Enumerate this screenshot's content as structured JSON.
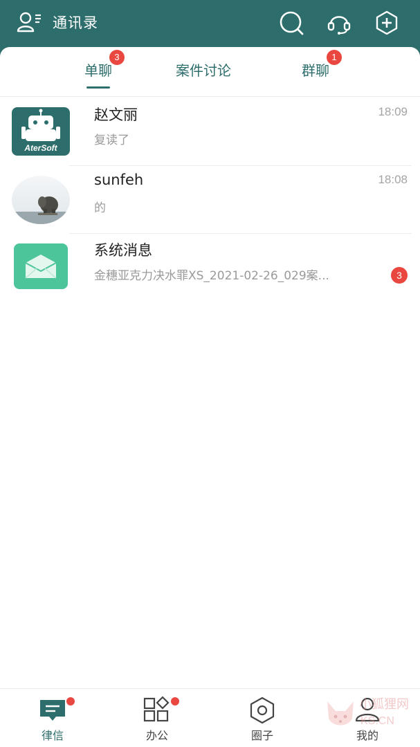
{
  "header": {
    "contacts_label": "通讯录",
    "icons": [
      "contacts-icon",
      "search-icon",
      "headset-icon",
      "add-icon"
    ]
  },
  "tabs": [
    {
      "label": "单聊",
      "badge": "3",
      "active": true
    },
    {
      "label": "案件讨论",
      "badge": "",
      "active": false
    },
    {
      "label": "群聊",
      "badge": "1",
      "active": false
    }
  ],
  "chats": [
    {
      "name": "赵文丽",
      "time": "18:09",
      "message": "复读了",
      "avatar_text": "AterSoft",
      "badge": ""
    },
    {
      "name": "sunfeh",
      "time": "18:08",
      "message": "的",
      "avatar_text": "",
      "badge": ""
    },
    {
      "name": "系统消息",
      "time": "",
      "message": "金穗亚克力决水罪XS_2021-02-26_029案...",
      "avatar_text": "",
      "badge": "3"
    }
  ],
  "bottom_nav": [
    {
      "label": "律信",
      "active": true,
      "dot": true
    },
    {
      "label": "办公",
      "active": false,
      "dot": true
    },
    {
      "label": "圈子",
      "active": false,
      "dot": false
    },
    {
      "label": "我的",
      "active": false,
      "dot": false
    }
  ],
  "watermark": {
    "line1": "小狐狸网",
    "line2": "KS.CN"
  },
  "colors": {
    "primary": "#2d6e6c",
    "badge": "#e9473f",
    "system_icon": "#4cc59a"
  }
}
